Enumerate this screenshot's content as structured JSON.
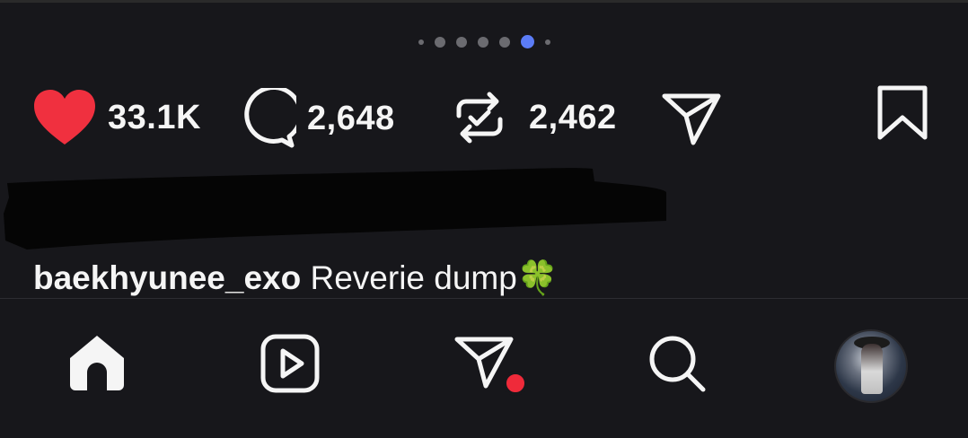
{
  "carousel": {
    "dot_count": 7,
    "active_index": 5
  },
  "actions": {
    "likes": "33.1K",
    "comments": "2,648",
    "reposts": "2,462"
  },
  "caption": {
    "username": "baekhyunee_exo",
    "text": "Reverie dump",
    "emoji": "🍀"
  },
  "colors": {
    "like": "#f0303f",
    "active_dot": "#5b7cf6",
    "notification": "#ef2a3a"
  },
  "icons": {
    "like": "heart-icon",
    "comment": "comment-icon",
    "repost": "repost-icon",
    "share": "send-icon",
    "save": "bookmark-icon",
    "home": "home-icon",
    "reels": "reels-icon",
    "messages": "send-icon",
    "search": "search-icon"
  }
}
